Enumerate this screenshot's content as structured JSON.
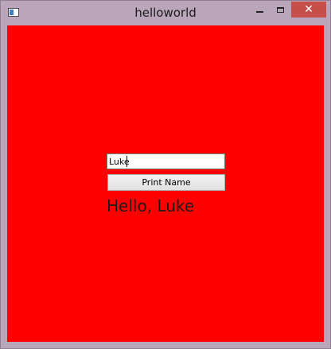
{
  "window": {
    "title": "helloworld",
    "icon": "application-icon",
    "controls": {
      "minimize": "minimize-icon",
      "maximize": "maximize-icon",
      "close": "✕"
    }
  },
  "form": {
    "name_value": "Luke",
    "button_label": "Print Name",
    "greeting": "Hello, Luke"
  },
  "colors": {
    "background": "#ff0000",
    "close_button": "#c74f4b"
  }
}
